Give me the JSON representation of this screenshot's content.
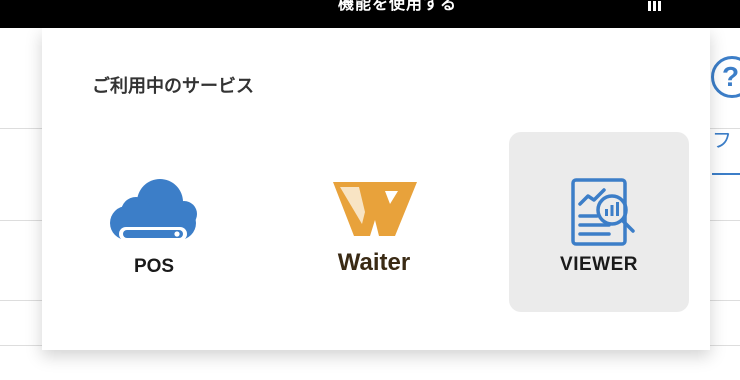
{
  "topbar": {
    "text": "機能を使用する"
  },
  "background": {
    "help_symbol": "?",
    "partial_tab_text": "フ"
  },
  "popup": {
    "title": "ご利用中のサービス",
    "services": [
      {
        "label": "POS",
        "icon": "cloud-pos-icon",
        "color": "#3c7ec8",
        "selected": false
      },
      {
        "label": "Waiter",
        "icon": "waiter-logo-icon",
        "color": "#e8a23b",
        "selected": false
      },
      {
        "label": "VIEWER",
        "icon": "viewer-report-icon",
        "color": "#3c7ec8",
        "selected": true
      }
    ]
  },
  "colors": {
    "accent_blue": "#3c7ec8",
    "waiter_orange": "#e8a23b",
    "waiter_text": "#3a2a14",
    "selected_bg": "#ebebeb"
  }
}
